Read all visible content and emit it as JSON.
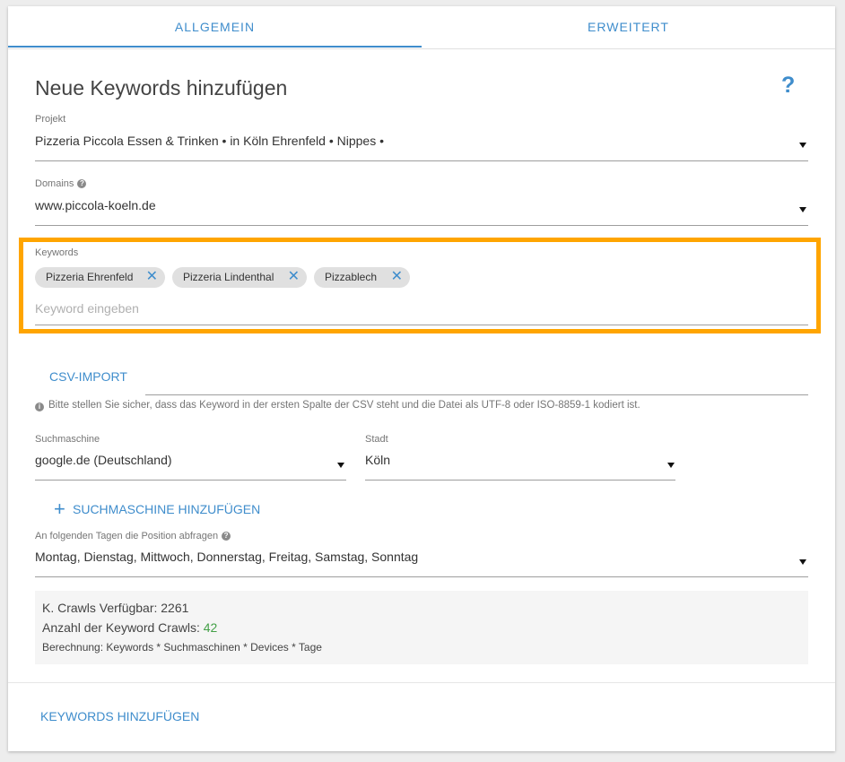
{
  "tabs": [
    {
      "label": "ALLGEMEIN",
      "active": true
    },
    {
      "label": "ERWEITERT",
      "active": false
    }
  ],
  "form": {
    "title": "Neue Keywords hinzufügen",
    "help_symbol": "?",
    "projekt": {
      "label": "Projekt",
      "value": "Pizzeria Piccola Essen & Trinken • in Köln Ehrenfeld • Nippes •"
    },
    "domains": {
      "label": "Domains",
      "value": "www.piccola-koeln.de"
    },
    "keywords": {
      "label": "Keywords",
      "chips": [
        "Pizzeria Ehrenfeld",
        "Pizzeria Lindenthal",
        "Pizzablech"
      ],
      "placeholder": "Keyword eingeben"
    },
    "csv_import": {
      "button_label": "CSV-IMPORT",
      "info": "Bitte stellen Sie sicher, dass das Keyword in der ersten Spalte der CSV steht und die Datei als UTF-8 oder ISO-8859-1 kodiert ist."
    },
    "suchmaschine": {
      "label": "Suchmaschine",
      "value": "google.de (Deutschland)"
    },
    "stadt": {
      "label": "Stadt",
      "value": "Köln"
    },
    "add_search_engine_label": "SUCHMASCHINE HINZUFÜGEN",
    "tage": {
      "label": "An folgenden Tagen die Position abfragen",
      "value": "Montag, Dienstag, Mittwoch, Donnerstag, Freitag, Samstag, Sonntag"
    },
    "crawls": {
      "available": "K. Crawls Verfügbar: 2261",
      "count_label": "Anzahl der Keyword Crawls:",
      "count_value": "42",
      "formula": "Berechnung: Keywords * Suchmaschinen * Devices * Tage"
    },
    "submit_label": "KEYWORDS HINZUFÜGEN"
  },
  "colors": {
    "accent": "#3f8dcc",
    "highlight": "#ffa500",
    "count_green": "#43a047"
  }
}
